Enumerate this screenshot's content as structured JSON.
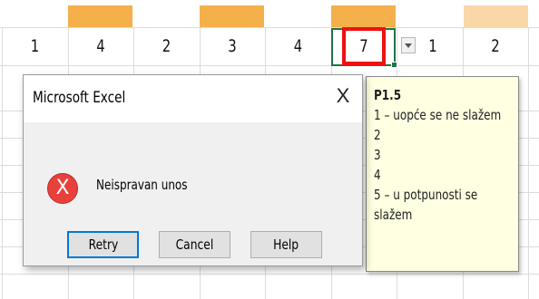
{
  "sheet": {
    "header_row_values": [
      "1",
      "4",
      "2",
      "3",
      "4",
      "7",
      "1",
      "2"
    ],
    "colors": {
      "header_bar_dark": "#f4b04a",
      "header_bar_light": "#fad7a8",
      "selection_border": "#217346",
      "highlight_box": "#ee1111"
    },
    "dropdown_icon": "chevron-down-icon"
  },
  "dialog": {
    "title": "Microsoft Excel",
    "close_label": "X",
    "icon": "error-icon",
    "icon_glyph": "X",
    "message": "Neispravan unos",
    "buttons": {
      "retry": "Retry",
      "cancel": "Cancel",
      "help": "Help"
    }
  },
  "input_message": {
    "title": "P1.5",
    "lines": [
      "1 – uopće se ne slažem",
      "2",
      "3",
      "4",
      "5 – u potpunosti se",
      "slažem"
    ]
  }
}
